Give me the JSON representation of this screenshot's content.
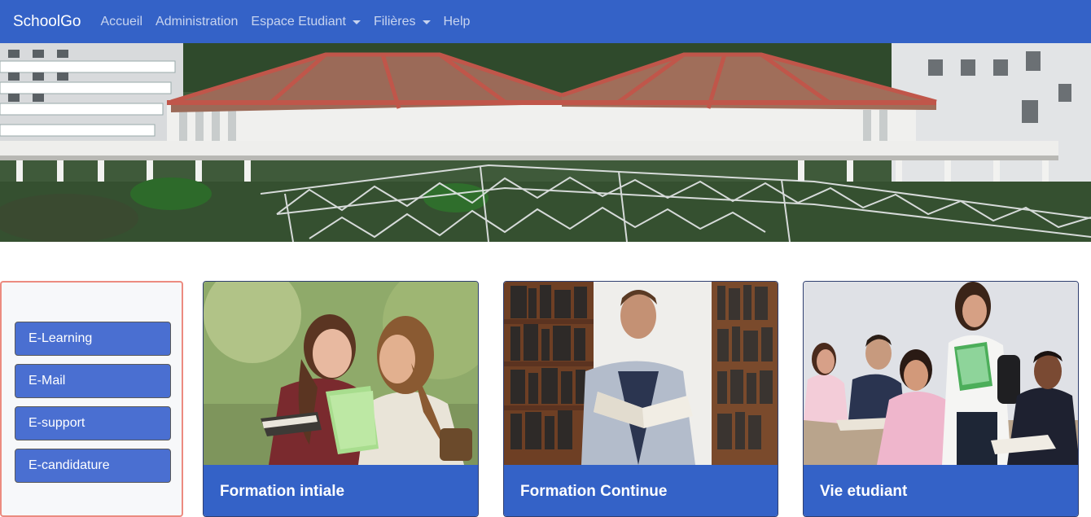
{
  "navbar": {
    "brand": "SchoolGo",
    "items": [
      {
        "label": "Accueil",
        "dropdown": false
      },
      {
        "label": "Administration",
        "dropdown": false
      },
      {
        "label": "Espace Etudiant",
        "dropdown": true
      },
      {
        "label": "Filières",
        "dropdown": true
      },
      {
        "label": "Help",
        "dropdown": false
      }
    ]
  },
  "sidebar": {
    "buttons": [
      {
        "label": "E-Learning"
      },
      {
        "label": "E-Mail"
      },
      {
        "label": "E-support"
      },
      {
        "label": "E-candidature"
      }
    ]
  },
  "cards": [
    {
      "title": "Formation intiale"
    },
    {
      "title": "Formation Continue"
    },
    {
      "title": "Vie etudiant"
    }
  ],
  "colors": {
    "primary": "#3462c7",
    "button": "#4a6fd1",
    "sidebar_border": "#ec8b80"
  }
}
